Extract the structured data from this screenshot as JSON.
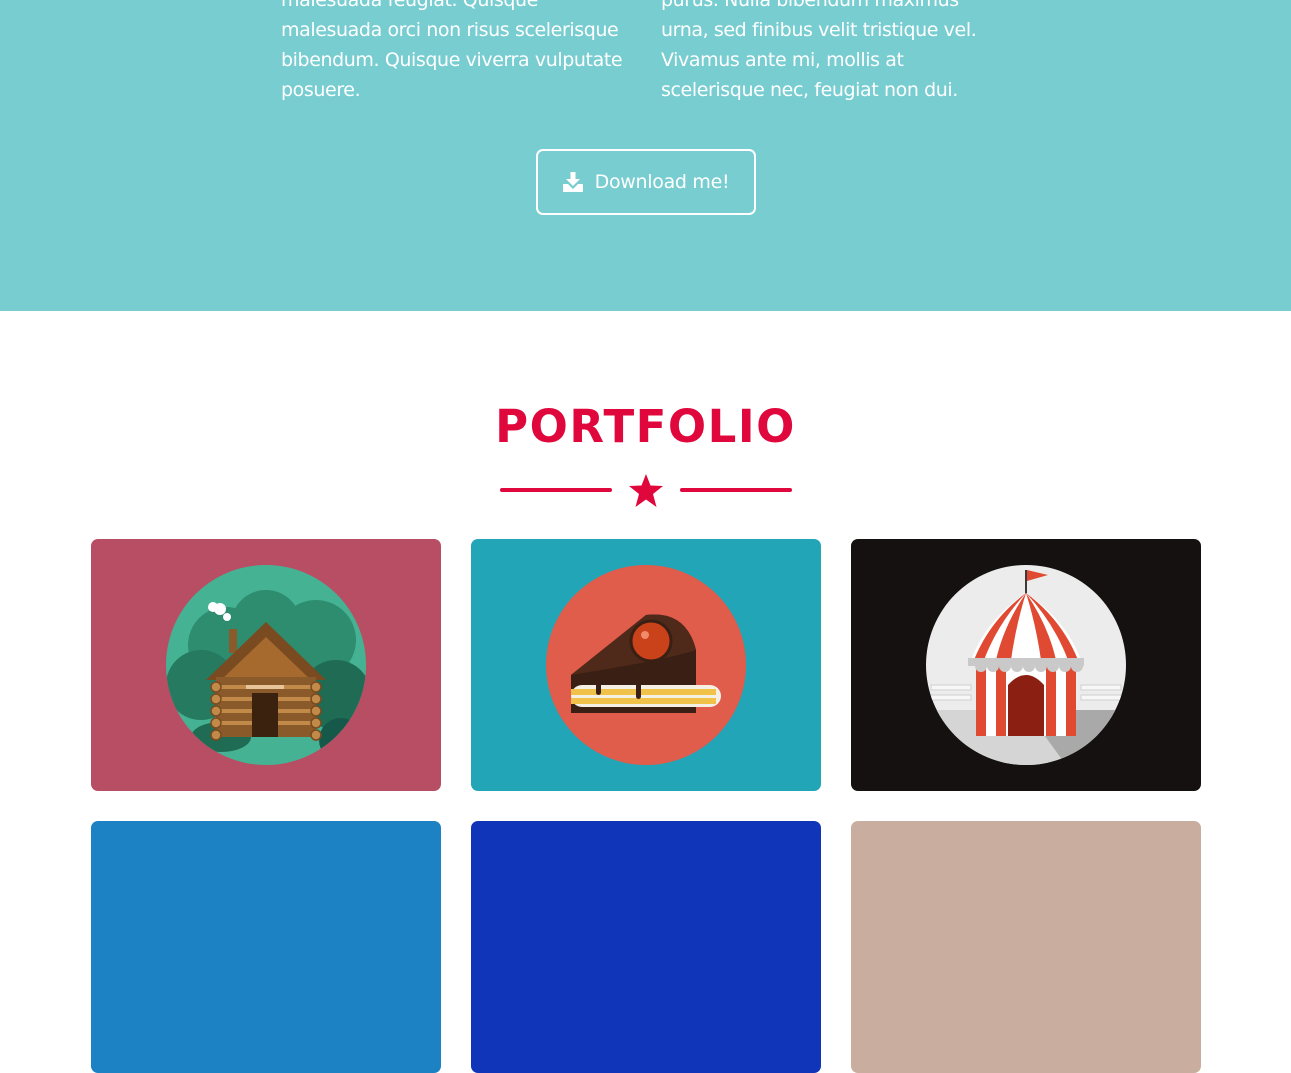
{
  "about": {
    "left_text": "malesuada feugiat. Quisque malesuada orci non risus scelerisque bibendum. Quisque viverra vulputate posuere.",
    "right_text": "purus. Nulla bibendum maximus urna, sed finibus velit tristique vel. Vivamus ante mi, mollis at scelerisque nec, feugiat non dui.",
    "download_label": "Download me!",
    "download_icon": "download-icon"
  },
  "portfolio": {
    "title": "PORTFOLIO",
    "divider_icon": "star-icon",
    "items": [
      {
        "name": "cabin",
        "icon": "cabin-icon",
        "bg": "#b84e64"
      },
      {
        "name": "cake",
        "icon": "cake-icon",
        "bg": "#21a5b7"
      },
      {
        "name": "circus",
        "icon": "circus-tent-icon",
        "bg": "#141110"
      },
      {
        "name": "item-4",
        "bg": "#1d82c4"
      },
      {
        "name": "item-5",
        "bg": "#1035b8"
      },
      {
        "name": "item-6",
        "bg": "#c9ae9f"
      }
    ]
  },
  "colors": {
    "about_bg": "#78cdd1",
    "accent": "#e0073d"
  }
}
